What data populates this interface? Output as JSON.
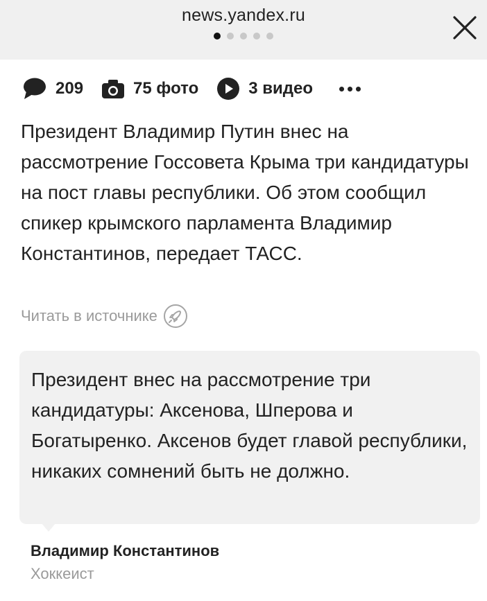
{
  "header": {
    "domain": "news.yandex.ru",
    "close_icon": "close-icon",
    "pagination": {
      "total": 5,
      "active_index": 0
    }
  },
  "stats": {
    "comments_count": "209",
    "photos_label": "75 фото",
    "videos_label": "3 видео",
    "icons": [
      "comment-bubble-icon",
      "camera-icon",
      "play-icon",
      "more-dots-icon"
    ]
  },
  "article": {
    "text": "Президент Владимир Путин внес на рассмотрение Госсовета Крыма три кандидатуры на пост главы республики. Об этом сообщил спикер крымского парламента Владимир Константинов, передает ТАСС.",
    "source_link": "Читать в источнике",
    "source_icon": "rocket-icon"
  },
  "quote": {
    "text": "Президент внес на рассмотрение три кандидатуры: Аксенова, Шперова и Богатыренко. Аксенов будет главой республики, никаких сомнений быть не должно.",
    "author_name": "Владимир Константинов",
    "author_role": "Хоккеист"
  }
}
